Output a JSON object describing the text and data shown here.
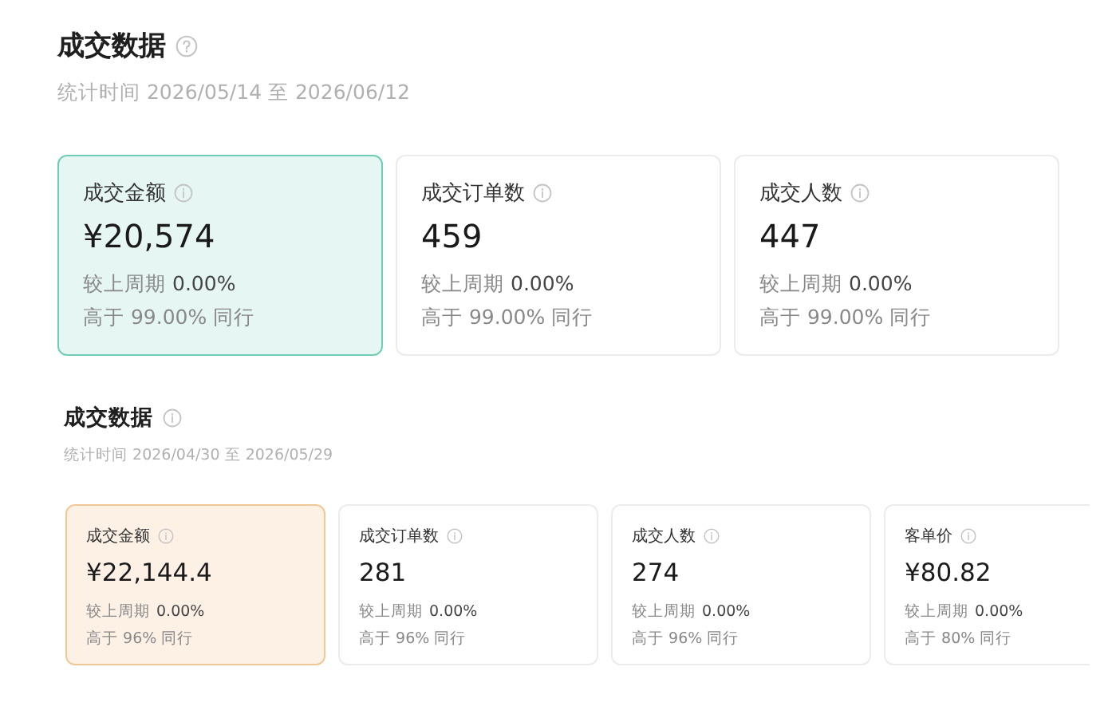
{
  "sections": [
    {
      "kind": "large",
      "title": "成交数据",
      "period": "统计时间 2026/05/14 至 2026/06/12",
      "cards": [
        {
          "label": "成交金额",
          "value": "¥20,574",
          "compare_label": "较上周期",
          "compare_value": "0.00%",
          "rank": "高于 99.00% 同行",
          "selected": true
        },
        {
          "label": "成交订单数",
          "value": "459",
          "compare_label": "较上周期",
          "compare_value": "0.00%",
          "rank": "高于 99.00% 同行",
          "selected": false
        },
        {
          "label": "成交人数",
          "value": "447",
          "compare_label": "较上周期",
          "compare_value": "0.00%",
          "rank": "高于 99.00% 同行",
          "selected": false
        }
      ]
    },
    {
      "kind": "compact",
      "title": "成交数据",
      "period": "统计时间 2026/04/30 至 2026/05/29",
      "cards": [
        {
          "label": "成交金额",
          "value": "¥22,144.4",
          "compare_label": "较上周期",
          "compare_value": "0.00%",
          "rank": "高于 96% 同行",
          "selected": true
        },
        {
          "label": "成交订单数",
          "value": "281",
          "compare_label": "较上周期",
          "compare_value": "0.00%",
          "rank": "高于 96% 同行",
          "selected": false
        },
        {
          "label": "成交人数",
          "value": "274",
          "compare_label": "较上周期",
          "compare_value": "0.00%",
          "rank": "高于 96% 同行",
          "selected": false
        },
        {
          "label": "客单价",
          "value": "¥80.82",
          "compare_label": "较上周期",
          "compare_value": "0.00%",
          "rank": "高于 80% 同行",
          "selected": false
        }
      ]
    }
  ]
}
